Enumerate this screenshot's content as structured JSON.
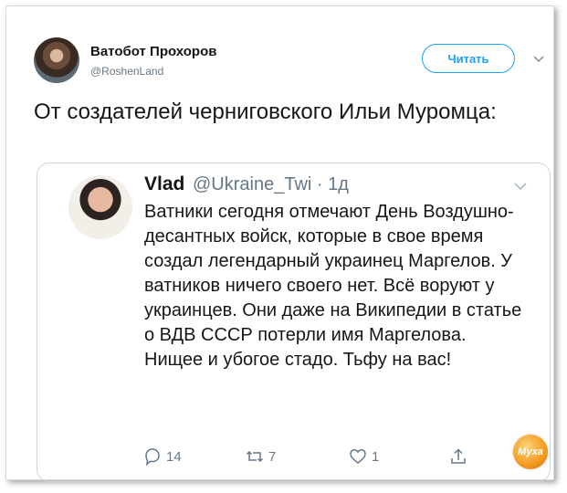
{
  "tweet": {
    "author_name": "Ватобот Прохоров",
    "author_handle": "@RoshenLand",
    "follow_label": "Читать",
    "text": "От создателей черниговского Ильи Муромца:"
  },
  "quoted": {
    "name": "Vlad",
    "handle_time": "@Ukraine_Twi · 1д",
    "text": "Ватники сегодня отмечают День Воздушно-десантных войск, которые в свое время создал легендарный украинец Маргелов. У ватников ничего своего нет. Всё воруют у украинцев. Они даже на Википедии в статье о ВДВ СССР потерли имя Маргелова. Нищее и убогое стадо. Тьфу на вас!",
    "reply_count": "14",
    "retweet_count": "7",
    "like_count": "1"
  },
  "watermark": {
    "text": "Муха"
  },
  "colors": {
    "accent": "#1da1f2",
    "muted": "#657786",
    "text": "#14171a",
    "border": "#ccd6dd"
  },
  "icons": [
    "avatar",
    "chevron-down-icon",
    "reply-icon",
    "retweet-icon",
    "like-icon",
    "share-icon"
  ]
}
